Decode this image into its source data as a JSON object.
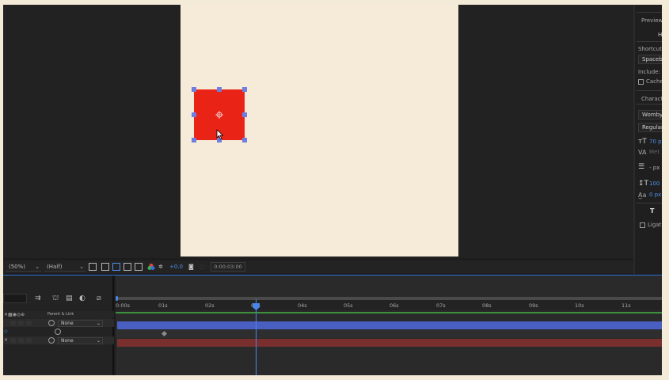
{
  "right_panel": {
    "preview_title": "Preview",
    "preview_glyph": "H",
    "shortcut_label": "Shortcut",
    "shortcut_value": "Spaceba",
    "include_label": "Include:",
    "cache_label": "Cache",
    "character_title": "Characte",
    "font_family": "Womby",
    "font_style": "Regular",
    "font_size": "70 p",
    "kerning": "Met",
    "leading": "- px",
    "vertical_scale": "100",
    "baseline_shift": "0 px",
    "text_style_icon": "T",
    "ligatures_label": "Ligat"
  },
  "toolbar": {
    "zoom": "(50%)",
    "resolution": "(Half)",
    "exposure": "+0.0",
    "timecode": "0:00:03:00"
  },
  "timeline": {
    "column_header": "Parent & Link",
    "layers": [
      {
        "parent": "None"
      },
      {
        "parent": ""
      },
      {
        "parent": "None"
      }
    ],
    "ruler": [
      "0:00s",
      "01s",
      "02s",
      "03s",
      "04s",
      "05s",
      "06s",
      "07s",
      "08s",
      "09s",
      "10s",
      "11s"
    ],
    "current_time_label": "03s"
  },
  "colors": {
    "shape_fill": "#ea2317",
    "canvas_bg": "#f5ebd8",
    "accent_blue": "#4a86e8",
    "layer_bar_blue": "#4a5fc2",
    "layer_bar_red": "#7a2f2f"
  }
}
